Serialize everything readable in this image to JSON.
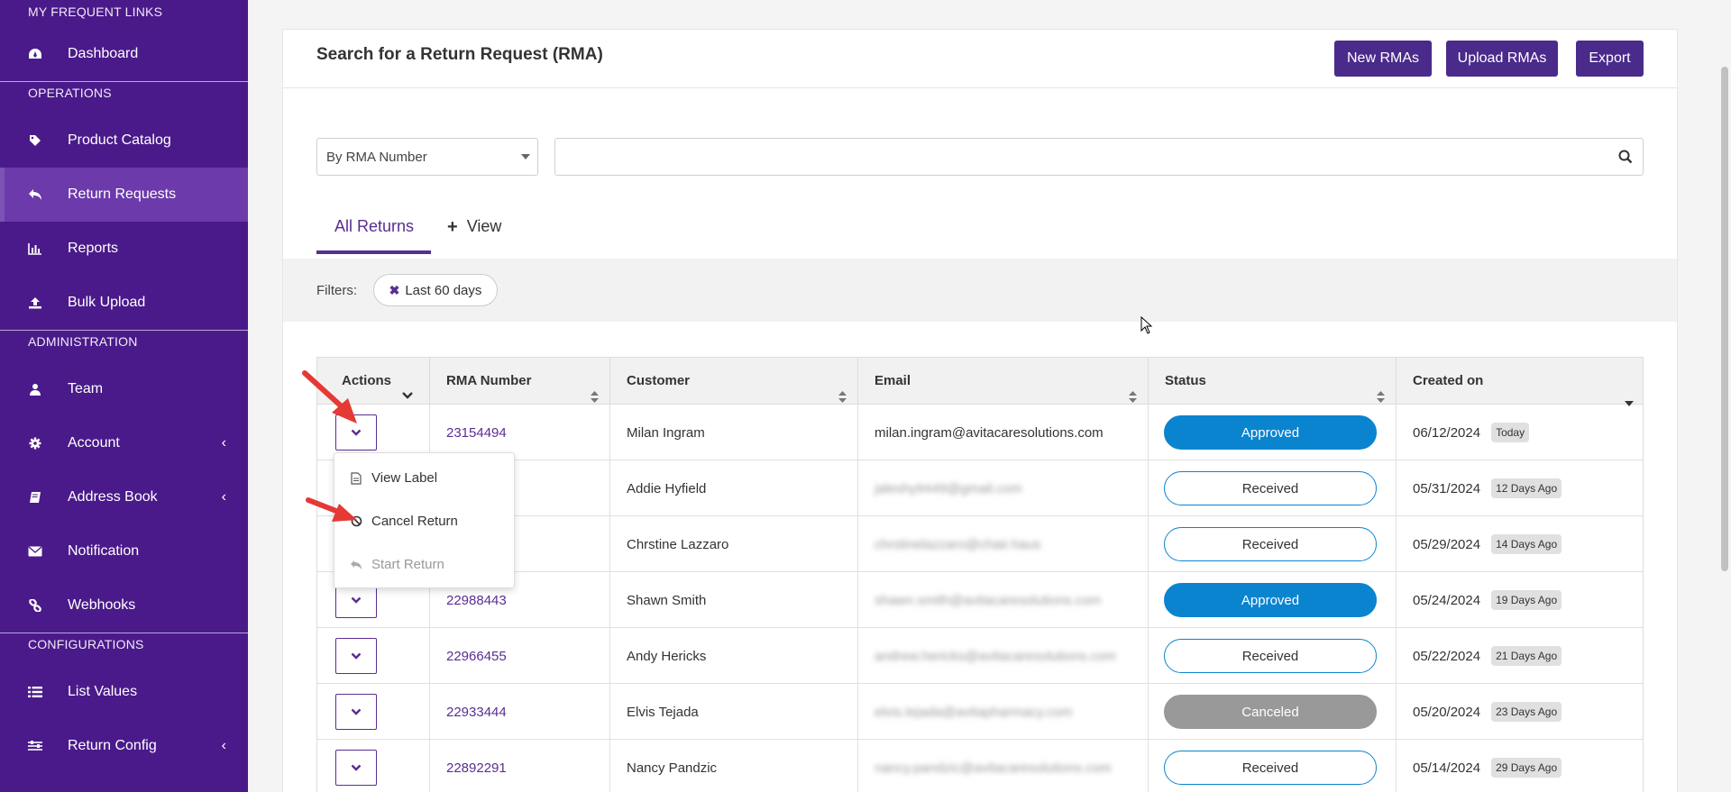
{
  "sidebar": {
    "sections": [
      {
        "title": "MY FREQUENT LINKS",
        "items": [
          {
            "label": "Dashboard",
            "icon": "dashboard-icon"
          }
        ]
      },
      {
        "title": "OPERATIONS",
        "items": [
          {
            "label": "Product Catalog",
            "icon": "tag-icon"
          },
          {
            "label": "Return Requests",
            "icon": "reply-icon",
            "active": true
          },
          {
            "label": "Reports",
            "icon": "bar-chart-icon"
          },
          {
            "label": "Bulk Upload",
            "icon": "upload-icon"
          }
        ]
      },
      {
        "title": "ADMINISTRATION",
        "items": [
          {
            "label": "Team",
            "icon": "user-icon"
          },
          {
            "label": "Account",
            "icon": "gear-icon",
            "caret": true
          },
          {
            "label": "Address Book",
            "icon": "book-icon",
            "caret": true
          },
          {
            "label": "Notification",
            "icon": "envelope-icon"
          },
          {
            "label": "Webhooks",
            "icon": "link-icon"
          }
        ]
      },
      {
        "title": "CONFIGURATIONS",
        "items": [
          {
            "label": "List Values",
            "icon": "list-icon"
          },
          {
            "label": "Return Config",
            "icon": "sliders-icon",
            "caret": true
          }
        ]
      }
    ]
  },
  "header": {
    "title": "Search for a Return Request (RMA)",
    "buttons": {
      "new": "New RMAs",
      "upload": "Upload RMAs",
      "export": "Export"
    }
  },
  "search": {
    "type_value": "By RMA Number",
    "query_value": ""
  },
  "tabs": {
    "all": "All Returns",
    "view": "View"
  },
  "filters": {
    "label": "Filters:",
    "chip": "Last 60 days"
  },
  "table": {
    "columns": [
      "Actions",
      "RMA Number",
      "Customer",
      "Email",
      "Status",
      "Created on"
    ],
    "rows": [
      {
        "rma": "23154494",
        "customer": "Milan Ingram",
        "email": "milan.ingram@avitacaresolutions.com",
        "status": "Approved",
        "date": "06/12/2024",
        "ago": "Today"
      },
      {
        "rma": "",
        "customer": "Addie Hyfield",
        "email": "jaleshy9449@gmail.com",
        "status": "Received",
        "date": "05/31/2024",
        "ago": "12 Days Ago"
      },
      {
        "rma": "",
        "customer": "Chrstine Lazzaro",
        "email": "chrstinelazzaro@chair.haus",
        "status": "Received",
        "date": "05/29/2024",
        "ago": "14 Days Ago"
      },
      {
        "rma": "22988443",
        "customer": "Shawn Smith",
        "email": "shawn.smith@avitacaresolutions.com",
        "status": "Approved",
        "date": "05/24/2024",
        "ago": "19 Days Ago"
      },
      {
        "rma": "22966455",
        "customer": "Andy Hericks",
        "email": "andrew.hericks@avitacaresolutions.com",
        "status": "Received",
        "date": "05/22/2024",
        "ago": "21 Days Ago"
      },
      {
        "rma": "22933444",
        "customer": "Elvis Tejada",
        "email": "elvis.tejada@avitapharmacy.com",
        "status": "Canceled",
        "date": "05/20/2024",
        "ago": "23 Days Ago"
      },
      {
        "rma": "22892291",
        "customer": "Nancy Pandzic",
        "email": "nancy.pandzic@avitacaresolutions.com",
        "status": "Received",
        "date": "05/14/2024",
        "ago": "29 Days Ago"
      }
    ]
  },
  "action_menu": {
    "items": [
      {
        "label": "View Label",
        "icon": "document-icon",
        "disabled": false
      },
      {
        "label": "Cancel Return",
        "icon": "ban-icon",
        "disabled": false
      },
      {
        "label": "Start Return",
        "icon": "reply-icon",
        "disabled": true
      }
    ]
  },
  "colors": {
    "sidebar_bg": "#4a1a8a",
    "sidebar_active": "#6c3aaa",
    "brand_purple": "#5a2d91",
    "approved": "#0b84d0",
    "canceled": "#999999",
    "annotation_arrow": "#e53935"
  }
}
